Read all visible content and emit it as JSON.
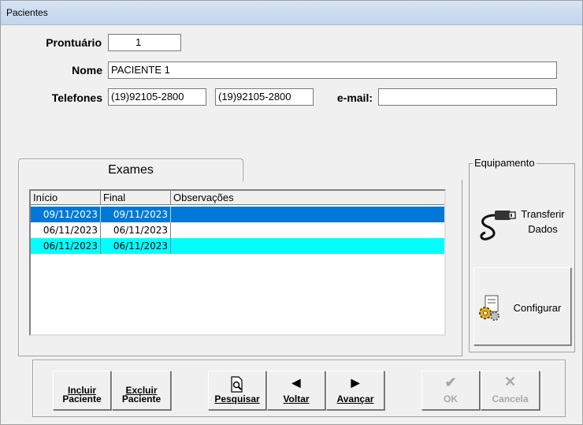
{
  "window": {
    "title": "Pacientes"
  },
  "form": {
    "prontuario_label": "Prontuário",
    "prontuario_value": "1",
    "nome_label": "Nome",
    "nome_value": "PACIENTE 1",
    "telefones_label": "Telefones",
    "telefone1_value": "(19)92105-2800",
    "telefone2_value": "(19)92105-2800",
    "email_label": "e-mail:",
    "email_value": ""
  },
  "exames": {
    "tab_label": "Exames",
    "columns": [
      "Início",
      "Final",
      "Observações"
    ],
    "rows": [
      {
        "inicio": "09/11/2023",
        "final": "09/11/2023",
        "obs": ""
      },
      {
        "inicio": "06/11/2023",
        "final": "06/11/2023",
        "obs": ""
      },
      {
        "inicio": "06/11/2023",
        "final": "06/11/2023",
        "obs": ""
      }
    ],
    "selected_color": "#0078d7",
    "highlight_color": "#00ffff"
  },
  "equipamento": {
    "group_label": "Equipamento",
    "transferir_line1": "Transferir",
    "transferir_line2": "Dados",
    "configurar_label": "Configurar"
  },
  "toolbar": {
    "incluir_line1": "Incluir",
    "incluir_line2": "Paciente",
    "excluir_line1": "Excluir",
    "excluir_line2": "Paciente",
    "pesquisar": "Pesquisar",
    "voltar": "Voltar",
    "avancar": "Avançar",
    "ok": "OK",
    "cancela": "Cancela"
  }
}
